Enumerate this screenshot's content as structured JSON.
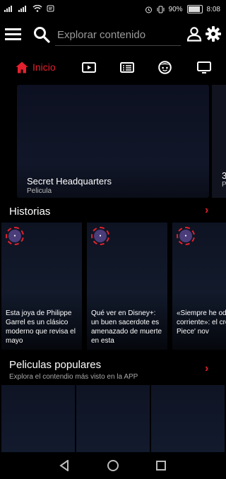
{
  "status": {
    "battery": "90%",
    "time": "8:08",
    "battery_level": 0.9
  },
  "header": {
    "search_placeholder": "Explorar contenido"
  },
  "tabs": [
    {
      "label": "Inicio",
      "icon": "home-icon",
      "active": true
    },
    {
      "icon": "play-icon"
    },
    {
      "icon": "list-icon"
    },
    {
      "icon": "kids-face-icon"
    },
    {
      "icon": "tv-icon"
    }
  ],
  "hero": {
    "title": "Secret Headquarters",
    "subtitle": "Pelicula",
    "next_title_partial": "3",
    "next_subtitle_partial": "P"
  },
  "historias": {
    "title": "Historias",
    "stories": [
      {
        "text": "Esta joya de Philippe Garrel es un clásico moderno que revisa el mayo"
      },
      {
        "text": "Qué ver en Disney+: un buen sacerdote es amenazado de muerte en esta"
      },
      {
        "text": "«Siempre he odi corriente»: el cre 'One Piece' nov"
      }
    ]
  },
  "populares": {
    "title": "Peliculas populares",
    "subtitle": "Explora el contendio más visto en la APP"
  },
  "colors": {
    "accent": "#e5202e",
    "background": "#000000"
  }
}
